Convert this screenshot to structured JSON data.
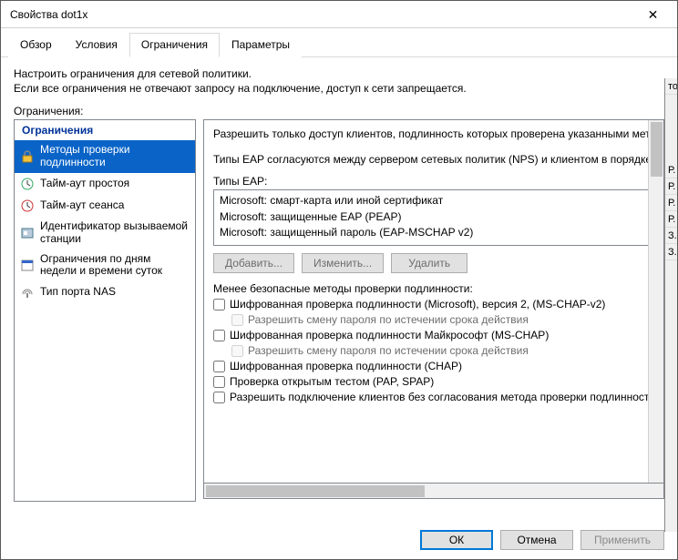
{
  "window": {
    "title": "Свойства dot1x"
  },
  "tabs": [
    "Обзор",
    "Условия",
    "Ограничения",
    "Параметры"
  ],
  "active_tab_index": 2,
  "description": {
    "line1": "Настроить ограничения для сетевой политики.",
    "line2": "Если все ограничения не отвечают запросу на подключение, доступ к сети запрещается."
  },
  "left_label": "Ограничения:",
  "sidebar": {
    "header": "Ограничения",
    "items": [
      {
        "label": "Методы проверки подлинности"
      },
      {
        "label": "Тайм-аут простоя"
      },
      {
        "label": "Тайм-аут сеанса"
      },
      {
        "label": "Идентификатор вызываемой станции"
      },
      {
        "label": "Ограничения по дням недели и времени суток"
      },
      {
        "label": "Тип порта NAS"
      }
    ]
  },
  "right": {
    "intro1": "Разрешить только доступ клиентов, подлинность которых проверена указанными мет",
    "intro2": "Типы EAP согласуются между сервером сетевых политик (NPS) и клиентом в порядке",
    "eap_label": "Типы EAP:",
    "eap_items": [
      "Microsoft: смарт-карта или иной сертификат",
      "Microsoft: защищенные EAP (PEAP)",
      "Microsoft: защищенный пароль (EAP-MSCHAP v2)"
    ],
    "btn_add": "Добавить...",
    "btn_edit": "Изменить...",
    "btn_del": "Удалить",
    "less_secure_label": "Менее безопасные методы проверки подлинности:",
    "checks": [
      {
        "label": "Шифрованная проверка подлинности (Microsoft), версия 2, (MS-CHAP-v2)",
        "sub": "Разрешить смену пароля по истечении срока действия"
      },
      {
        "label": "Шифрованная проверка подлинности Майкрософт (MS-CHAP)",
        "sub": "Разрешить смену пароля по истечении срока действия"
      },
      {
        "label": "Шифрованная проверка подлинности (CHAP)"
      },
      {
        "label": "Проверка открытым тестом (PAP, SPAP)"
      },
      {
        "label": "Разрешить подключение клиентов без согласования метода проверки подлинності"
      }
    ]
  },
  "footer": {
    "ok": "ОК",
    "cancel": "Отмена",
    "apply": "Применить"
  },
  "strip": [
    "то",
    "",
    "Р.",
    "Р.",
    "Р.",
    "Р.",
    "З.",
    "З."
  ]
}
